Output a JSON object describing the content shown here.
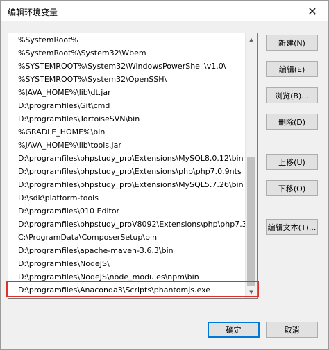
{
  "window": {
    "title": "编辑环境变量",
    "close_glyph": "✕"
  },
  "paths": [
    "%SystemRoot%",
    "%SystemRoot%\\System32\\Wbem",
    "%SYSTEMROOT%\\System32\\WindowsPowerShell\\v1.0\\",
    "%SYSTEMROOT%\\System32\\OpenSSH\\",
    "%JAVA_HOME%\\lib\\dt.jar",
    "D:\\programfiles\\Git\\cmd",
    "D:\\programfiles\\TortoiseSVN\\bin",
    "%GRADLE_HOME%\\bin",
    "%JAVA_HOME%\\lib\\tools.jar",
    "D:\\programfiles\\phpstudy_pro\\Extensions\\MySQL8.0.12\\bin",
    "D:\\programfiles\\phpstudy_pro\\Extensions\\php\\php7.0.9nts",
    "D:\\programfiles\\phpstudy_pro\\Extensions\\MySQL5.7.26\\bin",
    "D:\\sdk\\platform-tools",
    "D:\\programfiles\\010 Editor",
    "D:\\programfiles\\phpstudy_proV8092\\Extensions\\php\\php7.3...",
    "C:\\ProgramData\\ComposerSetup\\bin",
    "D:\\programfiles\\apache-maven-3.6.3\\bin",
    "D:\\programfiles\\NodeJS\\",
    "D:\\programfiles\\NodeJS\\node_modules\\npm\\bin",
    "D:\\programfiles\\Anaconda3\\Scripts\\phantomjs.exe"
  ],
  "selected_path": "D:\\programfiles\\Anaconda3\\Scripts\\phantomjs.exe",
  "buttons": {
    "new": "新建(N)",
    "edit": "编辑(E)",
    "browse": "浏览(B)...",
    "delete": "删除(D)",
    "move_up": "上移(U)",
    "move_down": "下移(O)",
    "edit_text": "编辑文本(T)...",
    "ok": "确定",
    "cancel": "取消"
  },
  "colors": {
    "highlight": "#d9312e",
    "primary_border": "#0078d7"
  },
  "scrollbar": {
    "up_glyph": "▲",
    "down_glyph": "▼"
  }
}
